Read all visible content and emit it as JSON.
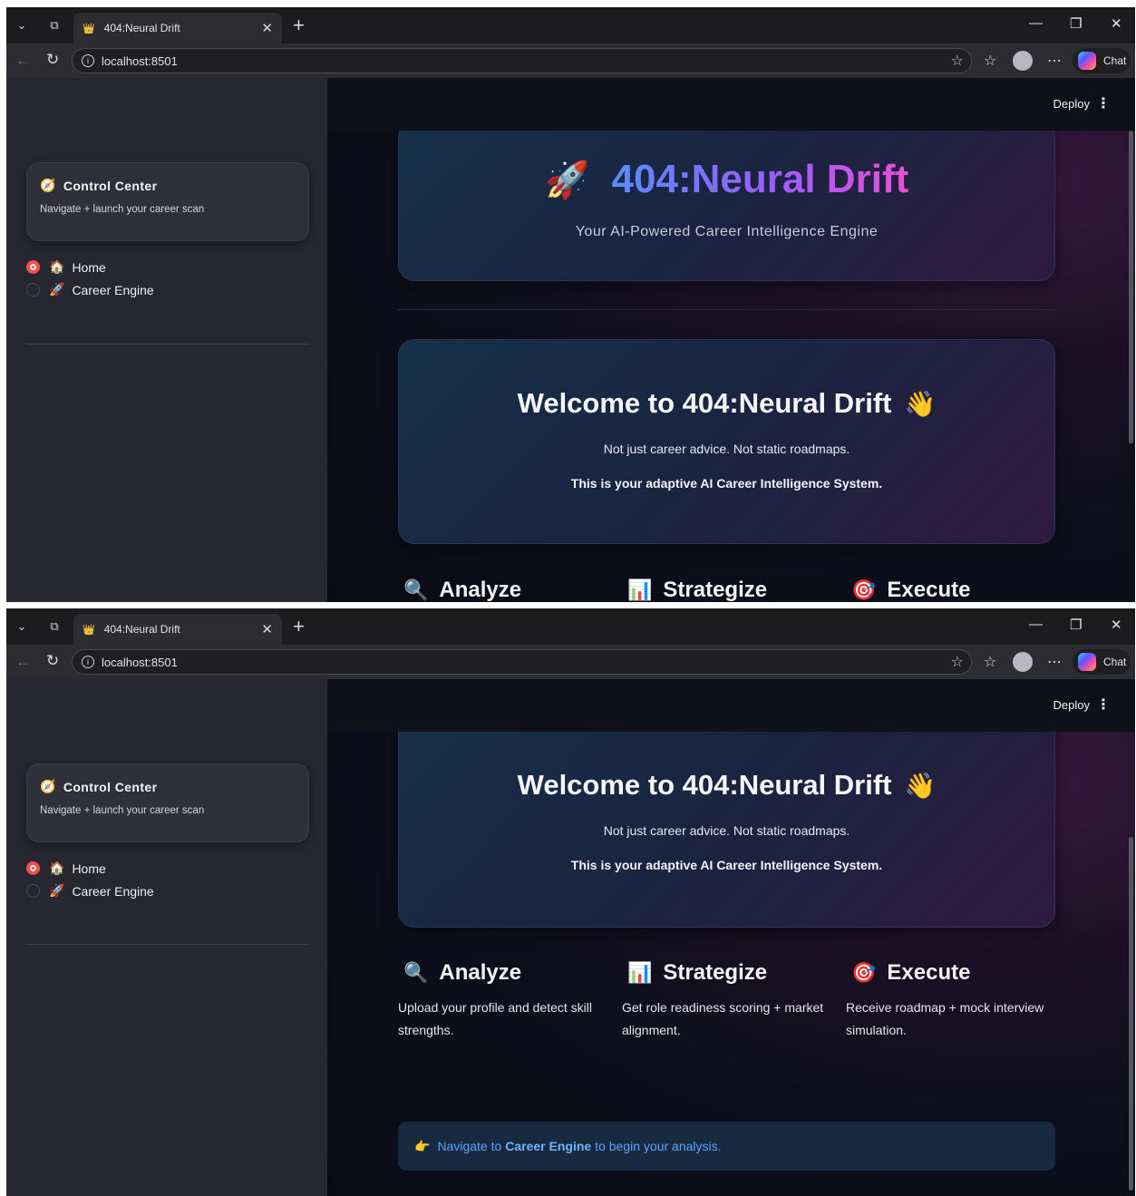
{
  "browser": {
    "tab_title": "404:Neural Drift",
    "url": "localhost:8501",
    "chat_label": "Chat"
  },
  "app": {
    "deploy_label": "Deploy",
    "sidebar": {
      "card_title": "Control Center",
      "card_subtitle": "Navigate + launch your career scan",
      "nav": [
        {
          "label": "Home",
          "emoji": "🏠",
          "selected": true
        },
        {
          "label": "Career Engine",
          "emoji": "🚀",
          "selected": false
        }
      ]
    },
    "hero": {
      "title": "404:Neural Drift",
      "subtitle": "Your AI-Powered Career Intelligence Engine"
    },
    "welcome": {
      "title": "Welcome to 404:Neural Drift",
      "line1": "Not just career advice. Not static roadmaps.",
      "line2": "This is your adaptive AI Career Intelligence System."
    },
    "features": [
      {
        "title": "Analyze",
        "icon": "magnifier-icon",
        "text": "Upload your profile and detect skill strengths."
      },
      {
        "title": "Strategize",
        "icon": "bar-chart-icon",
        "text": "Get role readiness scoring + market alignment."
      },
      {
        "title": "Execute",
        "icon": "target-icon",
        "text": "Receive roadmap + mock interview simulation."
      }
    ],
    "info": {
      "prefix": "Navigate to",
      "link": "Career Engine",
      "suffix": "to begin your analysis."
    }
  },
  "colors": {
    "sidebar_bg": "#262730",
    "header_bg": "#0e1117",
    "accent_red": "#ff4b4b",
    "info_text": "#5aa4ff"
  }
}
